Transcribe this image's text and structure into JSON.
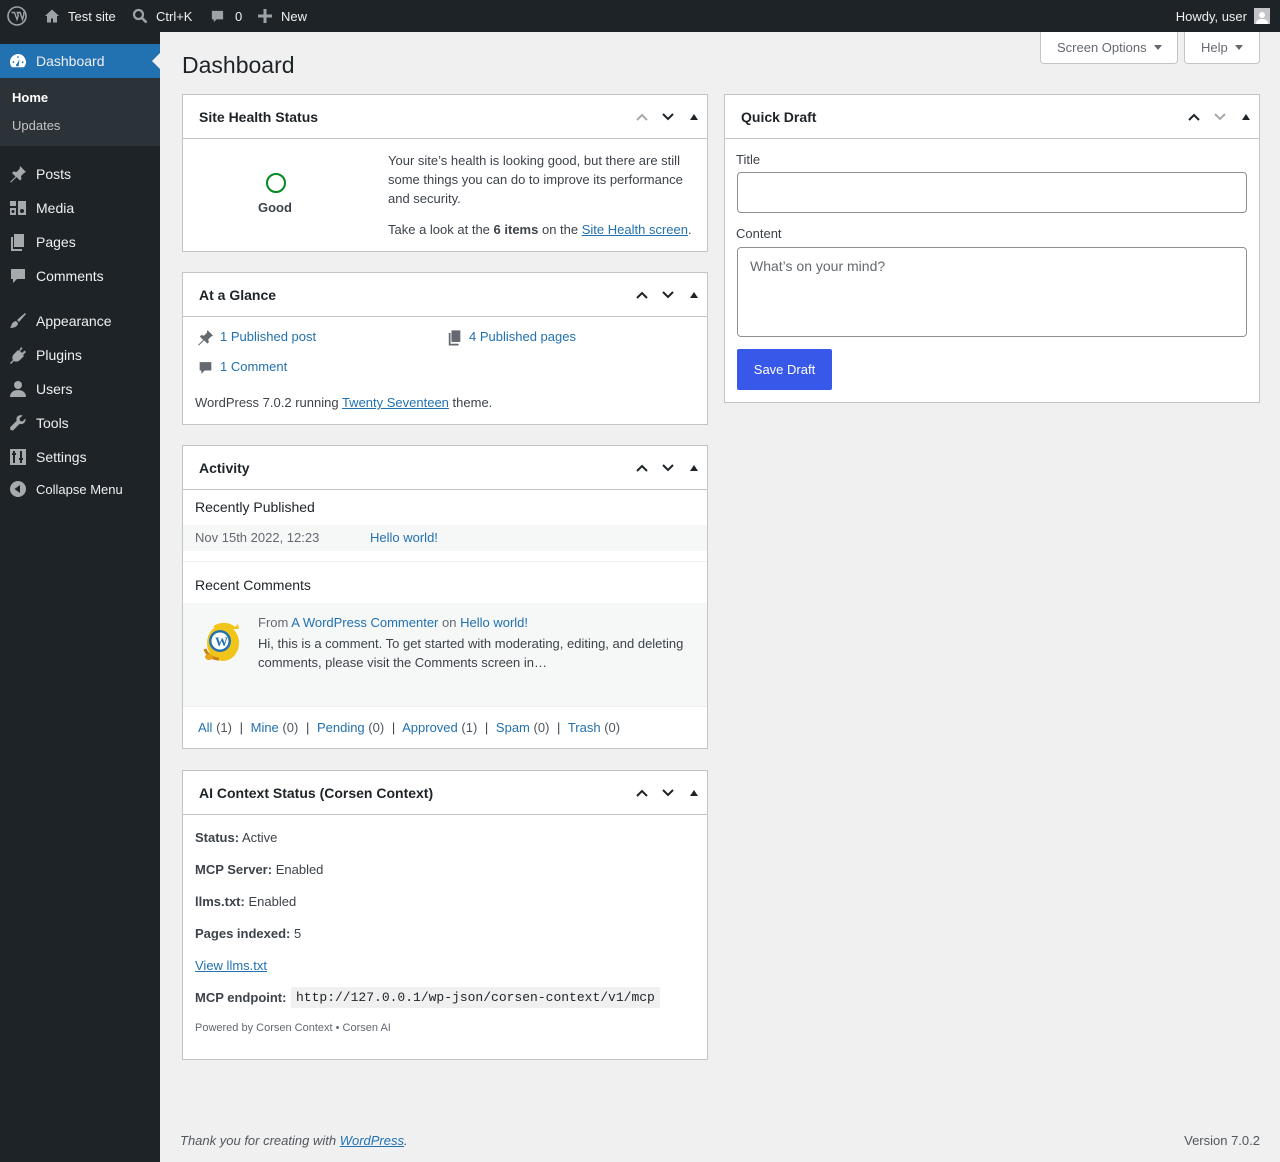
{
  "adminbar": {
    "site_name": "Test site",
    "search_shortcut": "Ctrl+K",
    "comments_count": "0",
    "new_label": "New",
    "greeting": "Howdy, user"
  },
  "sidebar": {
    "dashboard": "Dashboard",
    "submenu": [
      "Home",
      "Updates"
    ],
    "items": [
      "Posts",
      "Media",
      "Pages",
      "Comments",
      "Appearance",
      "Plugins",
      "Users",
      "Tools",
      "Settings"
    ],
    "collapse": "Collapse Menu"
  },
  "page": {
    "title": "Dashboard",
    "screen_options": "Screen Options",
    "help": "Help"
  },
  "site_health": {
    "title": "Site Health Status",
    "status": "Good",
    "message": "Your site’s health is looking good, but there are still some things you can do to improve its performance and security.",
    "items_prefix": "Take a look at the",
    "items_count": "6 items",
    "items_middle": "on the",
    "items_link": "Site Health screen",
    "items_end": "."
  },
  "glance": {
    "title": "At a Glance",
    "posts": "1 Published post",
    "pages": "4 Published pages",
    "comments": "1 Comment",
    "version_prefix": "WordPress 7.0.2 running",
    "theme": "Twenty Seventeen",
    "version_suffix": "theme."
  },
  "activity": {
    "title": "Activity",
    "recently_published": "Recently Published",
    "post_date": "Nov 15th 2022, 12:23",
    "post_title": "Hello world!",
    "recent_comments": "Recent Comments",
    "comment_from": "From",
    "comment_author": "A WordPress Commenter",
    "comment_on": "on",
    "comment_post": "Hello world!",
    "comment_text": "Hi, this is a comment. To get started with moderating, editing, and deleting comments, please visit the Comments screen in…",
    "filters": [
      {
        "label": "All",
        "count": "(1)"
      },
      {
        "label": "Mine",
        "count": "(0)"
      },
      {
        "label": "Pending",
        "count": "(0)"
      },
      {
        "label": "Approved",
        "count": "(1)"
      },
      {
        "label": "Spam",
        "count": "(0)"
      },
      {
        "label": "Trash",
        "count": "(0)"
      }
    ],
    "separator": "|"
  },
  "ai_context": {
    "title": "AI Context Status (Corsen Context)",
    "status_label": "Status:",
    "status_value": "Active",
    "mcp_label": "MCP Server:",
    "mcp_value": "Enabled",
    "llms_label": "llms.txt:",
    "llms_value": "Enabled",
    "pages_label": "Pages indexed:",
    "pages_value": "5",
    "view_link": "View llms.txt",
    "endpoint_label": "MCP endpoint:",
    "endpoint_value": "http://127.0.0.1/wp-json/corsen-context/v1/mcp",
    "powered": "Powered by Corsen Context • Corsen AI"
  },
  "quick_draft": {
    "title": "Quick Draft",
    "title_label": "Title",
    "title_value": "",
    "content_label": "Content",
    "content_placeholder": "What’s on your mind?",
    "save_button": "Save Draft"
  },
  "footer": {
    "thanks_prefix": "Thank you for creating with",
    "thanks_link": "WordPress",
    "thanks_suffix": ".",
    "version": "Version 7.0.2"
  },
  "colors": {
    "admin_bar": "#1d2327",
    "accent": "#2271b1",
    "button": "#3858e9",
    "health_good": "#008a20",
    "background": "#f0f0f1"
  }
}
